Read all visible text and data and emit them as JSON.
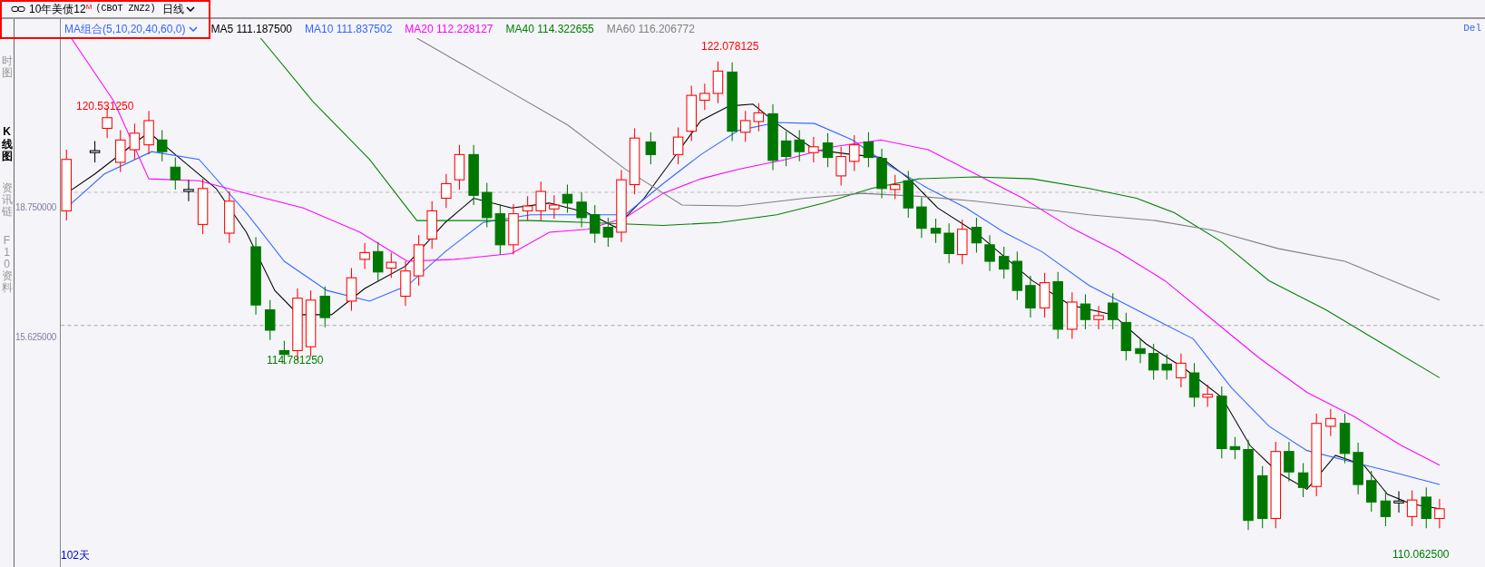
{
  "title_bar": {
    "instrument": "10年美债12",
    "superscript": "M",
    "code": "(CBOT ZNZ2)",
    "period": "日线"
  },
  "side_tabs": [
    {
      "label": "时图",
      "selected": false
    },
    {
      "label": "K线图",
      "selected": true
    },
    {
      "label": "资讯链",
      "selected": false
    },
    {
      "label": "F10资料",
      "selected": false
    }
  ],
  "indicator": {
    "name": "MA组合(5,10,20,40,60,0)",
    "legend": [
      {
        "label": "MA5 111.187500",
        "color": "#000000"
      },
      {
        "label": "MA10 111.837502",
        "color": "#3366ff"
      },
      {
        "label": "MA20 112.228127",
        "color": "#ff00ff"
      },
      {
        "label": "MA40 114.322655",
        "color": "#008000"
      },
      {
        "label": "MA60 116.206772",
        "color": "#808080"
      }
    ]
  },
  "right_link": "Del",
  "y_axis": {
    "ticks": [
      "18.750000",
      "15.625000"
    ]
  },
  "annotations": [
    {
      "text": "120.531250",
      "kind": "high"
    },
    {
      "text": "122.078125",
      "kind": "high"
    },
    {
      "text": "114.781250",
      "kind": "low"
    },
    {
      "text": "110.062500",
      "kind": "low"
    }
  ],
  "day_count": "102天"
}
